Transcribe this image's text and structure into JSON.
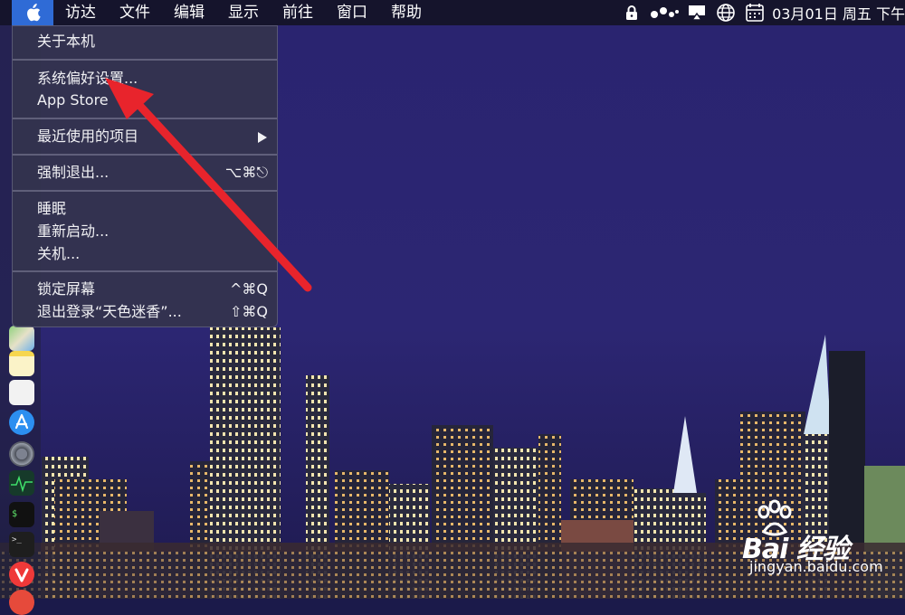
{
  "menubar": {
    "menus": [
      "访达",
      "文件",
      "编辑",
      "显示",
      "前往",
      "窗口",
      "帮助"
    ],
    "clock": "03月01日 周五 下午",
    "status_icons": [
      "lock-icon",
      "siri-dots-icon",
      "airplay-icon",
      "globe-icon",
      "calendar-icon"
    ]
  },
  "apple_menu": {
    "about": "关于本机",
    "system_prefs": "系统偏好设置...",
    "app_store": "App Store",
    "recent_items": "最近使用的项目",
    "force_quit": "强制退出...",
    "force_quit_shortcut": "⌥⌘⎋",
    "sleep": "睡眠",
    "restart": "重新启动...",
    "shutdown": "关机...",
    "lock_screen": "锁定屏幕",
    "lock_screen_shortcut": "^⌘Q",
    "logout": "退出登录“天色迷香”...",
    "logout_shortcut": "⇧⌘Q"
  },
  "dock": {
    "apps": [
      "maps-icon",
      "notes-icon",
      "reminders-icon",
      "app-store-icon",
      "system-preferences-icon",
      "activity-monitor-icon",
      "terminal-icon",
      "console-icon",
      "vivaldi-icon",
      "partial-app-icon"
    ]
  },
  "watermark": {
    "brand": "Bai 经验",
    "url": "jingyan.baidu.com"
  },
  "colors": {
    "menubar_bg": "#15142c",
    "apple_highlight": "#2f6bd6",
    "sky": "#2a2470",
    "arrow": "#e8242c"
  }
}
